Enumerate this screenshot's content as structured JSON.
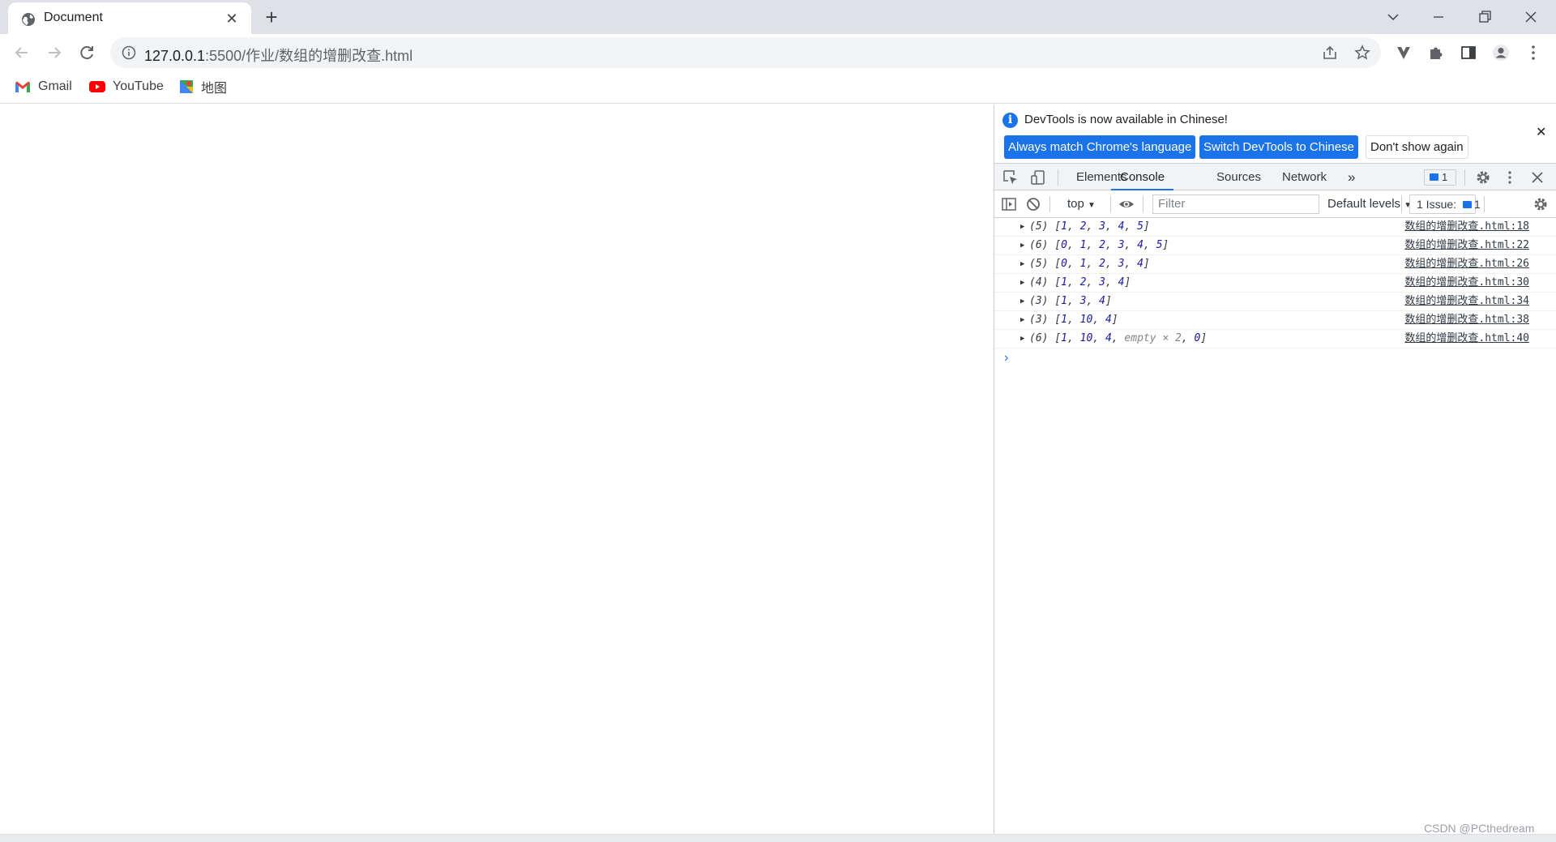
{
  "browser": {
    "tab": {
      "title": "Document",
      "favicon": "globe-icon",
      "close_icon": "close-icon"
    },
    "new_tab_icon": "plus-icon",
    "window_controls": [
      "chevron-down-icon",
      "minimize-icon",
      "restore-icon",
      "close-icon"
    ],
    "address": {
      "host": "127.0.0.1",
      "rest": ":5500/作业/数组的增删改查.html"
    },
    "bookmarks": [
      {
        "label": "Gmail",
        "icon": "gmail-icon"
      },
      {
        "label": "YouTube",
        "icon": "youtube-icon"
      },
      {
        "label": "地图",
        "icon": "maps-icon"
      }
    ]
  },
  "devtools": {
    "infobar": {
      "message": "DevTools is now available in Chinese!",
      "btn_match": "Always match Chrome's language",
      "btn_switch": "Switch DevTools to Chinese",
      "btn_dismiss": "Don't show again"
    },
    "tabs": {
      "elements": "Elements",
      "console": "Console",
      "sources": "Sources",
      "network": "Network",
      "more": "»"
    },
    "issues_badge": "1",
    "console_bar": {
      "context": "top",
      "filter_placeholder": "Filter",
      "levels": "Default levels",
      "issues_label": "1 Issue:",
      "issues_count": "1"
    },
    "logs": [
      {
        "count": "(5)",
        "items": [
          "1",
          "2",
          "3",
          "4",
          "5"
        ],
        "source": "数组的增删改查.html:18"
      },
      {
        "count": "(6)",
        "items": [
          "0",
          "1",
          "2",
          "3",
          "4",
          "5"
        ],
        "source": "数组的增删改查.html:22"
      },
      {
        "count": "(5)",
        "items": [
          "0",
          "1",
          "2",
          "3",
          "4"
        ],
        "source": "数组的增删改查.html:26"
      },
      {
        "count": "(4)",
        "items": [
          "1",
          "2",
          "3",
          "4"
        ],
        "source": "数组的增删改查.html:30"
      },
      {
        "count": "(3)",
        "items": [
          "1",
          "3",
          "4"
        ],
        "source": "数组的增删改查.html:34"
      },
      {
        "count": "(3)",
        "items": [
          "1",
          "10",
          "4"
        ],
        "source": "数组的增删改查.html:38"
      },
      {
        "count": "(6)",
        "items": [
          "1",
          "10",
          "4",
          "empty × 2",
          "0"
        ],
        "source": "数组的增删改查.html:40"
      }
    ],
    "prompt": "›"
  },
  "watermark": "CSDN @PCthedream"
}
